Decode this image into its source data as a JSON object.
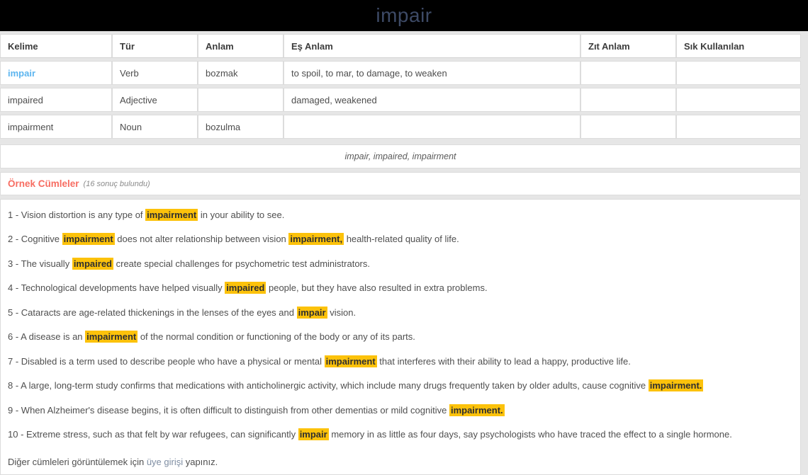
{
  "header": {
    "word": "impair"
  },
  "word_table": {
    "columns": [
      "Kelime",
      "Tür",
      "Anlam",
      "Eş Anlam",
      "Zıt Anlam",
      "Sık Kullanılan"
    ],
    "rows": [
      {
        "kelime": "impair",
        "kelime_is_link": true,
        "tur": "Verb",
        "anlam": "bozmak",
        "es_anlam": "to spoil, to mar, to damage, to weaken",
        "zit_anlam": "",
        "sik_kullanilan": ""
      },
      {
        "kelime": "impaired",
        "kelime_is_link": false,
        "tur": "Adjective",
        "anlam": "",
        "es_anlam": "damaged, weakened",
        "zit_anlam": "",
        "sik_kullanilan": ""
      },
      {
        "kelime": "impairment",
        "kelime_is_link": false,
        "tur": "Noun",
        "anlam": "bozulma",
        "es_anlam": "",
        "zit_anlam": "",
        "sik_kullanilan": ""
      }
    ]
  },
  "variants_strip": {
    "text": "impair, impaired, impairment"
  },
  "examples_header": {
    "title": "Örnek Cümleler",
    "count": "(16 sonuç bulundu)"
  },
  "sentences": [
    {
      "number": "1 - ",
      "parts": [
        {
          "t": "Vision distortion is any type of ",
          "h": false
        },
        {
          "t": "impairment",
          "h": true
        },
        {
          "t": " in your ability to see.",
          "h": false
        }
      ]
    },
    {
      "number": "2 - ",
      "parts": [
        {
          "t": "Cognitive ",
          "h": false
        },
        {
          "t": "impairment",
          "h": true
        },
        {
          "t": " does not alter relationship between vision ",
          "h": false
        },
        {
          "t": "impairment,",
          "h": true
        },
        {
          "t": " health-related quality of life.",
          "h": false
        }
      ]
    },
    {
      "number": "3 - ",
      "parts": [
        {
          "t": "The visually ",
          "h": false
        },
        {
          "t": "impaired",
          "h": true
        },
        {
          "t": " create special challenges for psychometric test administrators.",
          "h": false
        }
      ]
    },
    {
      "number": "4 - ",
      "parts": [
        {
          "t": "Technological developments have helped visually ",
          "h": false
        },
        {
          "t": "impaired",
          "h": true
        },
        {
          "t": " people, but they have also resulted in extra problems.",
          "h": false
        }
      ]
    },
    {
      "number": "5 - ",
      "parts": [
        {
          "t": "Cataracts are age-related thickenings in the lenses of the eyes and ",
          "h": false
        },
        {
          "t": "impair",
          "h": true
        },
        {
          "t": " vision.",
          "h": false
        }
      ]
    },
    {
      "number": "6 - ",
      "parts": [
        {
          "t": "A disease is an ",
          "h": false
        },
        {
          "t": "impairment",
          "h": true
        },
        {
          "t": " of the normal condition or functioning of the body or any of its parts.",
          "h": false
        }
      ]
    },
    {
      "number": "7 - ",
      "parts": [
        {
          "t": "Disabled is a term used to describe people who have a physical or mental ",
          "h": false
        },
        {
          "t": "impairment",
          "h": true
        },
        {
          "t": " that interferes with their ability to lead a happy, productive life.",
          "h": false
        }
      ]
    },
    {
      "number": "8 - ",
      "parts": [
        {
          "t": "A large, long-term study confirms that medications with anticholinergic activity, which include many drugs frequently taken by older adults, cause cognitive ",
          "h": false
        },
        {
          "t": "impairment.",
          "h": true
        }
      ]
    },
    {
      "number": "9 - ",
      "parts": [
        {
          "t": "When Alzheimer's disease begins, it is often difficult to distinguish from other dementias or mild cognitive ",
          "h": false
        },
        {
          "t": "impairment.",
          "h": true
        }
      ]
    },
    {
      "number": "10 - ",
      "parts": [
        {
          "t": "Extreme stress, such as that felt by war refugees, can significantly ",
          "h": false
        },
        {
          "t": "impair",
          "h": true
        },
        {
          "t": " memory in as little as four days, say psychologists who have traced the effect to a single hormone.",
          "h": false
        }
      ]
    }
  ],
  "login_note": {
    "before": "Diğer cümleleri görüntülemek için ",
    "link": "üye girişi",
    "after": " yapınız."
  },
  "colors": {
    "header_bg": "#000000",
    "header_word": "#3d4a66",
    "word_link": "#5cb5ef",
    "examples_title": "#f76d62",
    "highlight": "#fcc20b",
    "login_link": "#7f8ea3"
  }
}
